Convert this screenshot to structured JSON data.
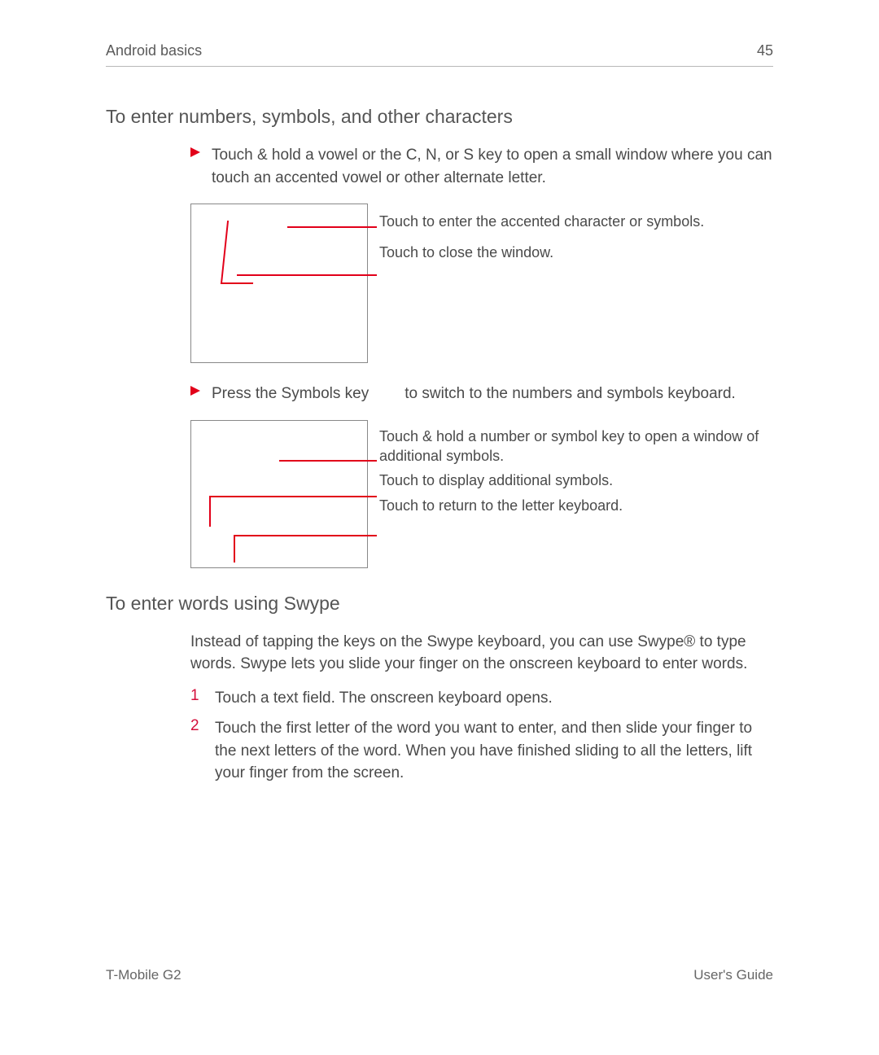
{
  "header": {
    "section": "Android basics",
    "page_number": "45"
  },
  "section1": {
    "title": "To enter numbers, symbols, and other characters",
    "bullet1": "Touch & hold a vowel or the C, N, or S key to open a small window where you can touch an accented vowel or other alternate letter.",
    "fig1_callout1": "Touch to enter the accented character or symbols.",
    "fig1_callout2": "Touch to close the window.",
    "bullet2_pre": "Press the Symbols key",
    "bullet2_post": "to switch to the numbers and symbols keyboard.",
    "fig2_callout1": "Touch & hold a number or symbol key to open a window of additional symbols.",
    "fig2_callout2": "Touch to display additional symbols.",
    "fig2_callout3": "Touch to return to the letter keyboard."
  },
  "section2": {
    "title": "To enter words using Swype",
    "intro": "Instead of tapping the keys on the Swype keyboard, you can use Swype® to type words. Swype lets you slide your finger on the onscreen keyboard to enter words.",
    "steps": [
      {
        "n": "1",
        "text": "Touch a text field. The onscreen keyboard opens."
      },
      {
        "n": "2",
        "text": "Touch the first letter of the word you want to enter, and then slide your finger to the next letters of the word. When you have finished sliding to all the letters, lift your finger from the screen."
      }
    ]
  },
  "footer": {
    "left": "T-Mobile G2",
    "right": "User's Guide"
  }
}
